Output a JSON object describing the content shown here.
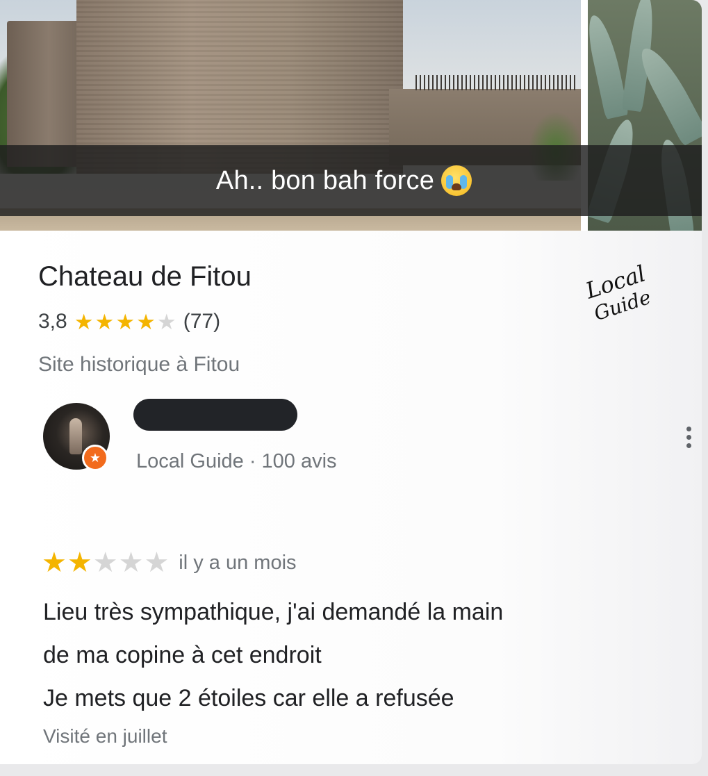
{
  "photo": {
    "caption": "Ah.. bon bah force",
    "caption_emoji": "loudly-crying-face-icon"
  },
  "place": {
    "name": "Chateau de Fitou",
    "rating": "3,8",
    "rating_value": 3.8,
    "review_count": "(77)",
    "category": "Site historique à Fitou",
    "signature_lines": [
      "Local",
      "Guide"
    ]
  },
  "reviewer": {
    "name_redacted": true,
    "meta": "Local Guide · 100 avis",
    "badge_icon": "local-guide-star-icon",
    "more_icon": "more-vert-icon"
  },
  "review": {
    "stars": 2,
    "stars_max": 5,
    "time": "il y a un mois",
    "lines": [
      "Lieu très sympathique, j'ai demandé la main",
      "de ma copine à cet endroit",
      "Je mets que 2 étoiles car elle a refusée"
    ],
    "visited": "Visité en juillet"
  },
  "colors": {
    "star_on": "#f4b400",
    "star_off": "#d5d5d5",
    "badge": "#f26b1d"
  }
}
